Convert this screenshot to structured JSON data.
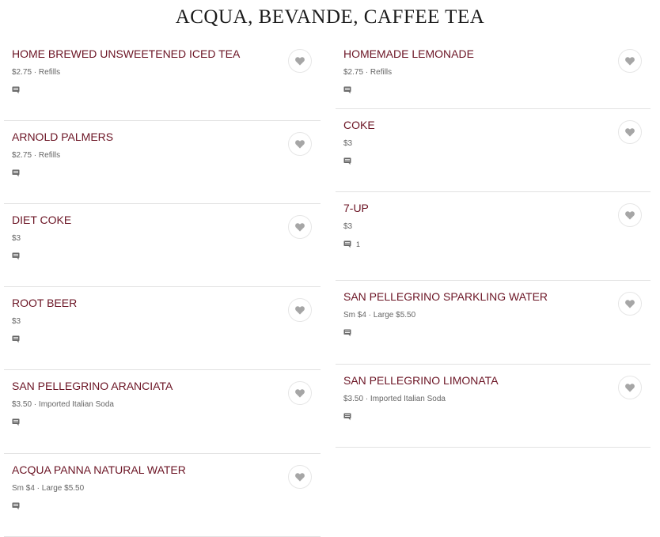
{
  "section": {
    "title": "ACQUA, BEVANDE, CAFFEE TEA"
  },
  "colors": {
    "item_name": "#6b1424",
    "divider": "#e2e2e2",
    "heart": "#a6a6a6"
  },
  "left_items": [
    {
      "name": "HOME BREWED UNSWEETENED ICED TEA",
      "meta": "$2.75 · Refills",
      "comments": ""
    },
    {
      "name": "ARNOLD PALMERS",
      "meta": "$2.75 · Refills",
      "comments": ""
    },
    {
      "name": "DIET COKE",
      "meta": "$3",
      "comments": ""
    },
    {
      "name": "ROOT BEER",
      "meta": "$3",
      "comments": ""
    },
    {
      "name": "SAN PELLEGRINO ARANCIATA",
      "meta": "$3.50 · Imported Italian Soda",
      "comments": ""
    },
    {
      "name": "ACQUA PANNA NATURAL WATER",
      "meta": "Sm $4 · Large $5.50",
      "comments": ""
    }
  ],
  "right_items": [
    {
      "name": "HOMEMADE LEMONADE",
      "meta": "$2.75 · Refills",
      "comments": ""
    },
    {
      "name": "COKE",
      "meta": "$3",
      "comments": ""
    },
    {
      "name": "7-UP",
      "meta": "$3",
      "comments": "1"
    },
    {
      "name": "SAN PELLEGRINO SPARKLING WATER",
      "meta": "Sm $4 · Large $5.50",
      "comments": ""
    },
    {
      "name": "SAN PELLEGRINO LIMONATA",
      "meta": "$3.50 · Imported Italian Soda",
      "comments": ""
    }
  ],
  "icons": {
    "favorite": "heart-icon",
    "comments": "comment-icon"
  }
}
